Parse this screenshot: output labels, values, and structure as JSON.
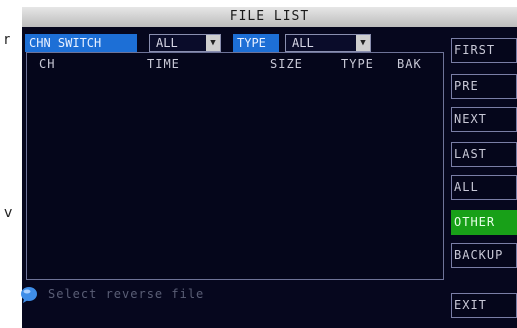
{
  "edge_text": {
    "top_char": "r",
    "bottom_char": "v"
  },
  "title": "FILE LIST",
  "filters": {
    "chn_switch_label": "CHN SWITCH",
    "chn_value": "ALL",
    "type_label": "TYPE",
    "type_value": "ALL"
  },
  "table": {
    "columns": [
      "CH",
      "TIME",
      "SIZE",
      "TYPE",
      "BAK"
    ],
    "rows": []
  },
  "side_buttons": [
    "FIRST",
    "PRE",
    "NEXT",
    "LAST",
    "ALL",
    "OTHER",
    "BACKUP"
  ],
  "active_button": "OTHER",
  "status_text": "Select reverse file",
  "exit_label": "EXIT",
  "colors": {
    "background": "#06071e",
    "label_highlight": "#1d6fd6",
    "active_button": "#18a018"
  },
  "icons": {
    "status": "info-bubble-icon",
    "dropdown": "dropdown-arrow-icon"
  }
}
